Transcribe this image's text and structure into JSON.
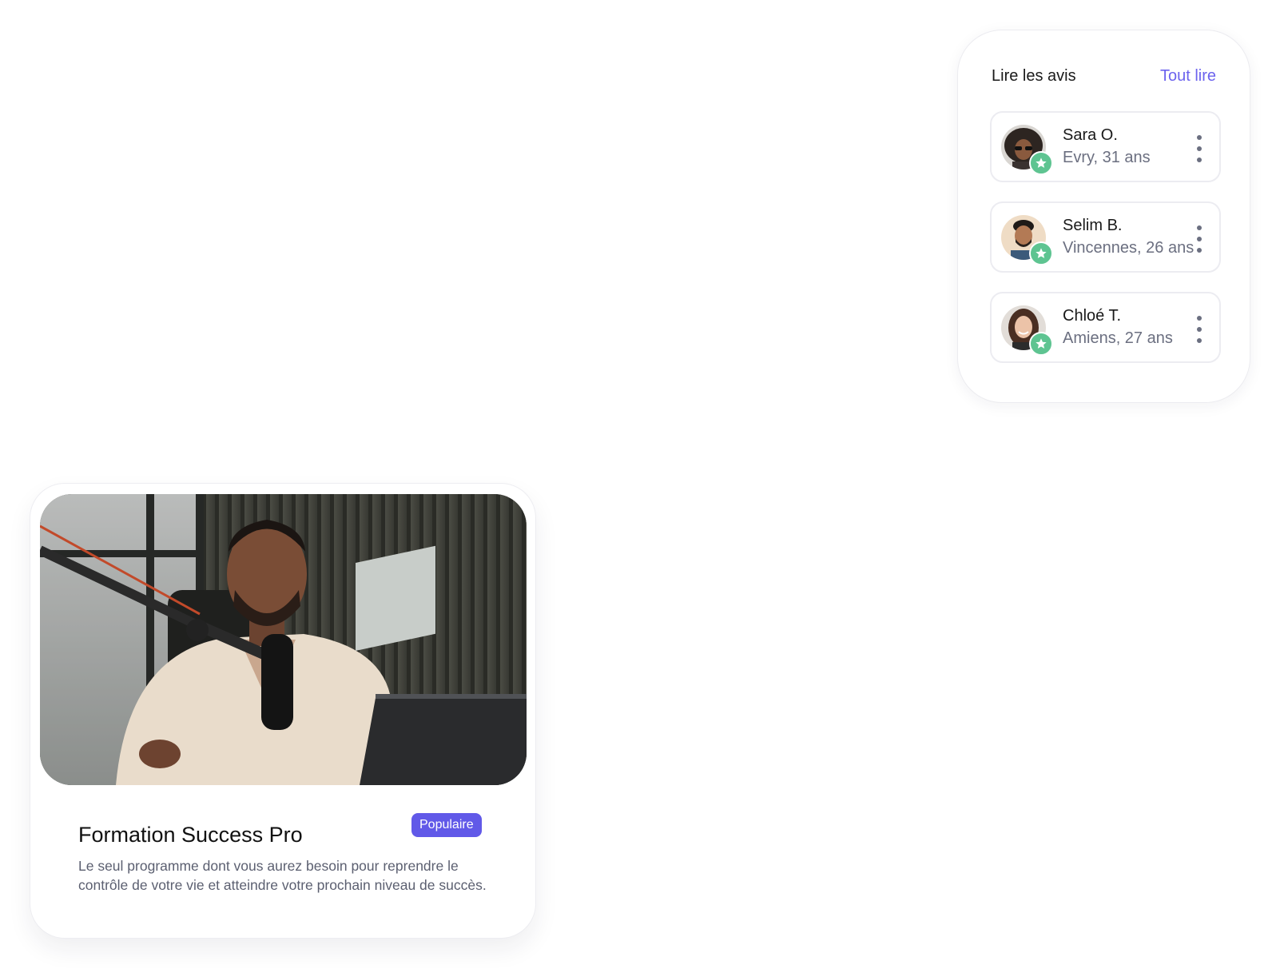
{
  "reviews": {
    "title": "Lire les avis",
    "read_all": "Tout lire",
    "items": [
      {
        "name": "Sara O.",
        "meta": "Evry, 31 ans"
      },
      {
        "name": "Selim B.",
        "meta": "Vincennes, 26 ans"
      },
      {
        "name": "Chloé T.",
        "meta": "Amiens, 27 ans"
      }
    ]
  },
  "course": {
    "title": "Formation Success Pro",
    "badge": "Populaire",
    "description": "Le seul programme dont vous aurez besoin pour reprendre le contrôle de votre vie et atteindre votre prochain niveau de succès."
  },
  "colors": {
    "accent": "#6159e8",
    "link": "#6c63ee",
    "star_badge": "#5ec491"
  },
  "icons": [
    "star-icon",
    "more-vertical-icon"
  ]
}
